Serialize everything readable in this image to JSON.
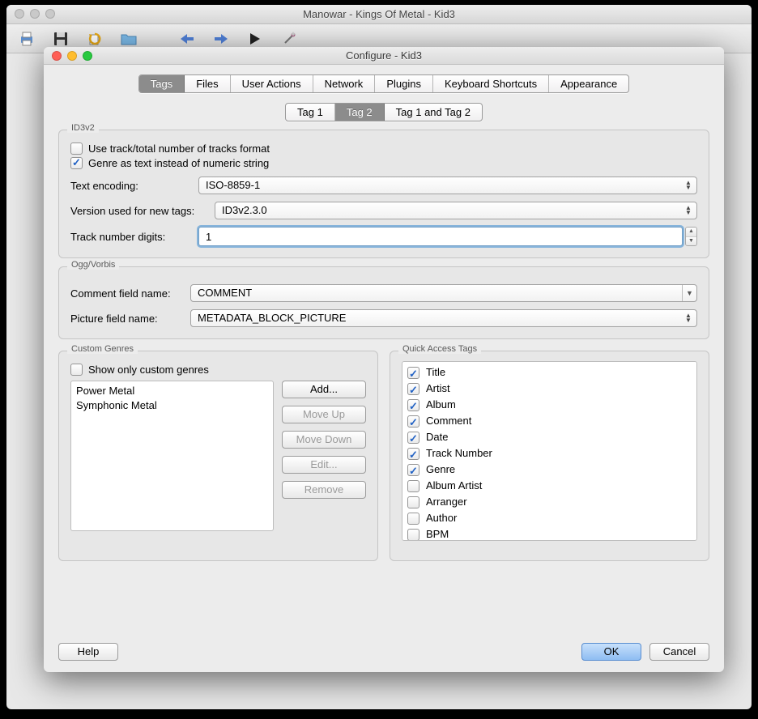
{
  "main_window": {
    "title": "Manowar - Kings Of Metal - Kid3"
  },
  "dialog": {
    "title": "Configure - Kid3",
    "main_tabs": [
      "Tags",
      "Files",
      "User Actions",
      "Network",
      "Plugins",
      "Keyboard Shortcuts",
      "Appearance"
    ],
    "main_tab_active": 0,
    "sub_tabs": [
      "Tag 1",
      "Tag 2",
      "Tag 1 and Tag 2"
    ],
    "sub_tab_active": 1,
    "id3v2": {
      "title": "ID3v2",
      "use_track_total_label": "Use track/total number of tracks format",
      "use_track_total_checked": false,
      "genre_text_label": "Genre as text instead of numeric string",
      "genre_text_checked": true,
      "text_encoding_label": "Text encoding:",
      "text_encoding_value": "ISO-8859-1",
      "version_label": "Version used for new tags:",
      "version_value": "ID3v2.3.0",
      "track_digits_label": "Track number digits:",
      "track_digits_value": "1"
    },
    "ogg": {
      "title": "Ogg/Vorbis",
      "comment_label": "Comment field name:",
      "comment_value": "COMMENT",
      "picture_label": "Picture field name:",
      "picture_value": "METADATA_BLOCK_PICTURE"
    },
    "custom_genres": {
      "title": "Custom Genres",
      "show_only_label": "Show only custom genres",
      "show_only_checked": false,
      "items": [
        "Power Metal",
        "Symphonic Metal"
      ],
      "buttons": {
        "add": "Add...",
        "move_up": "Move Up",
        "move_down": "Move Down",
        "edit": "Edit...",
        "remove": "Remove"
      }
    },
    "quick_access": {
      "title": "Quick Access Tags",
      "items": [
        {
          "label": "Title",
          "checked": true
        },
        {
          "label": "Artist",
          "checked": true
        },
        {
          "label": "Album",
          "checked": true
        },
        {
          "label": "Comment",
          "checked": true
        },
        {
          "label": "Date",
          "checked": true
        },
        {
          "label": "Track Number",
          "checked": true
        },
        {
          "label": "Genre",
          "checked": true
        },
        {
          "label": "Album Artist",
          "checked": false
        },
        {
          "label": "Arranger",
          "checked": false
        },
        {
          "label": "Author",
          "checked": false
        },
        {
          "label": "BPM",
          "checked": false
        }
      ]
    },
    "footer": {
      "help": "Help",
      "ok": "OK",
      "cancel": "Cancel"
    }
  }
}
